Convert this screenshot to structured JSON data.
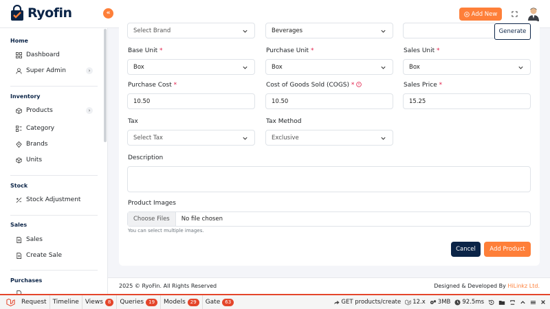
{
  "header": {
    "logo_text": "Ryofin",
    "collapse_icon": "double-chevron-left-icon",
    "add_new_label": "Add New",
    "colors": {
      "accent": "#fe7f39",
      "navy": "#0b2447"
    }
  },
  "sidebar": {
    "sections": {
      "home": "Home",
      "inventory": "Inventory",
      "stock": "Stock",
      "sales": "Sales",
      "purchases": "Purchases"
    },
    "items": {
      "dashboard": "Dashboard",
      "super_admin": "Super Admin",
      "products": "Products",
      "category": "Category",
      "brands": "Brands",
      "units": "Units",
      "stock_adjustment": "Stock Adjustment",
      "sales": "Sales",
      "create_sale": "Create Sale"
    }
  },
  "form": {
    "brand_select": "Select Brand",
    "category_select": "Beverages",
    "generate_label": "Generate",
    "base_unit_label": "Base Unit",
    "base_unit_value": "Box",
    "purchase_unit_label": "Purchase Unit",
    "purchase_unit_value": "Box",
    "sales_unit_label": "Sales Unit",
    "sales_unit_value": "Box",
    "purchase_cost_label": "Purchase Cost",
    "purchase_cost_value": "10.50",
    "cogs_label": "Cost of Goods Sold (COGS)",
    "cogs_value": "10.50",
    "sales_price_label": "Sales Price",
    "sales_price_value": "15.25",
    "tax_label": "Tax",
    "tax_value": "Select Tax",
    "tax_method_label": "Tax Method",
    "tax_method_value": "Exclusive",
    "description_label": "Description",
    "product_images_label": "Product Images",
    "choose_files_label": "Choose Files",
    "no_file_text": "No file chosen",
    "images_hint": "You can select multiple images.",
    "cancel_label": "Cancel",
    "add_product_label": "Add Product",
    "required_mark": "*"
  },
  "footer": {
    "copyright": "2025 © RyoFin. All Rights Reserved",
    "designed_by": "Designed & Developed By",
    "designer": "HiLinkz Ltd."
  },
  "debugbar": {
    "tabs": {
      "request": "Request",
      "timeline": "Timeline",
      "views": "Views",
      "queries": "Queries",
      "models": "Models",
      "gate": "Gate"
    },
    "counts": {
      "views": "8",
      "queries": "19",
      "models": "29",
      "gate": "63"
    },
    "route": "GET products/create",
    "php_version": "12.x",
    "memory": "3MB",
    "duration": "92.5ms"
  }
}
